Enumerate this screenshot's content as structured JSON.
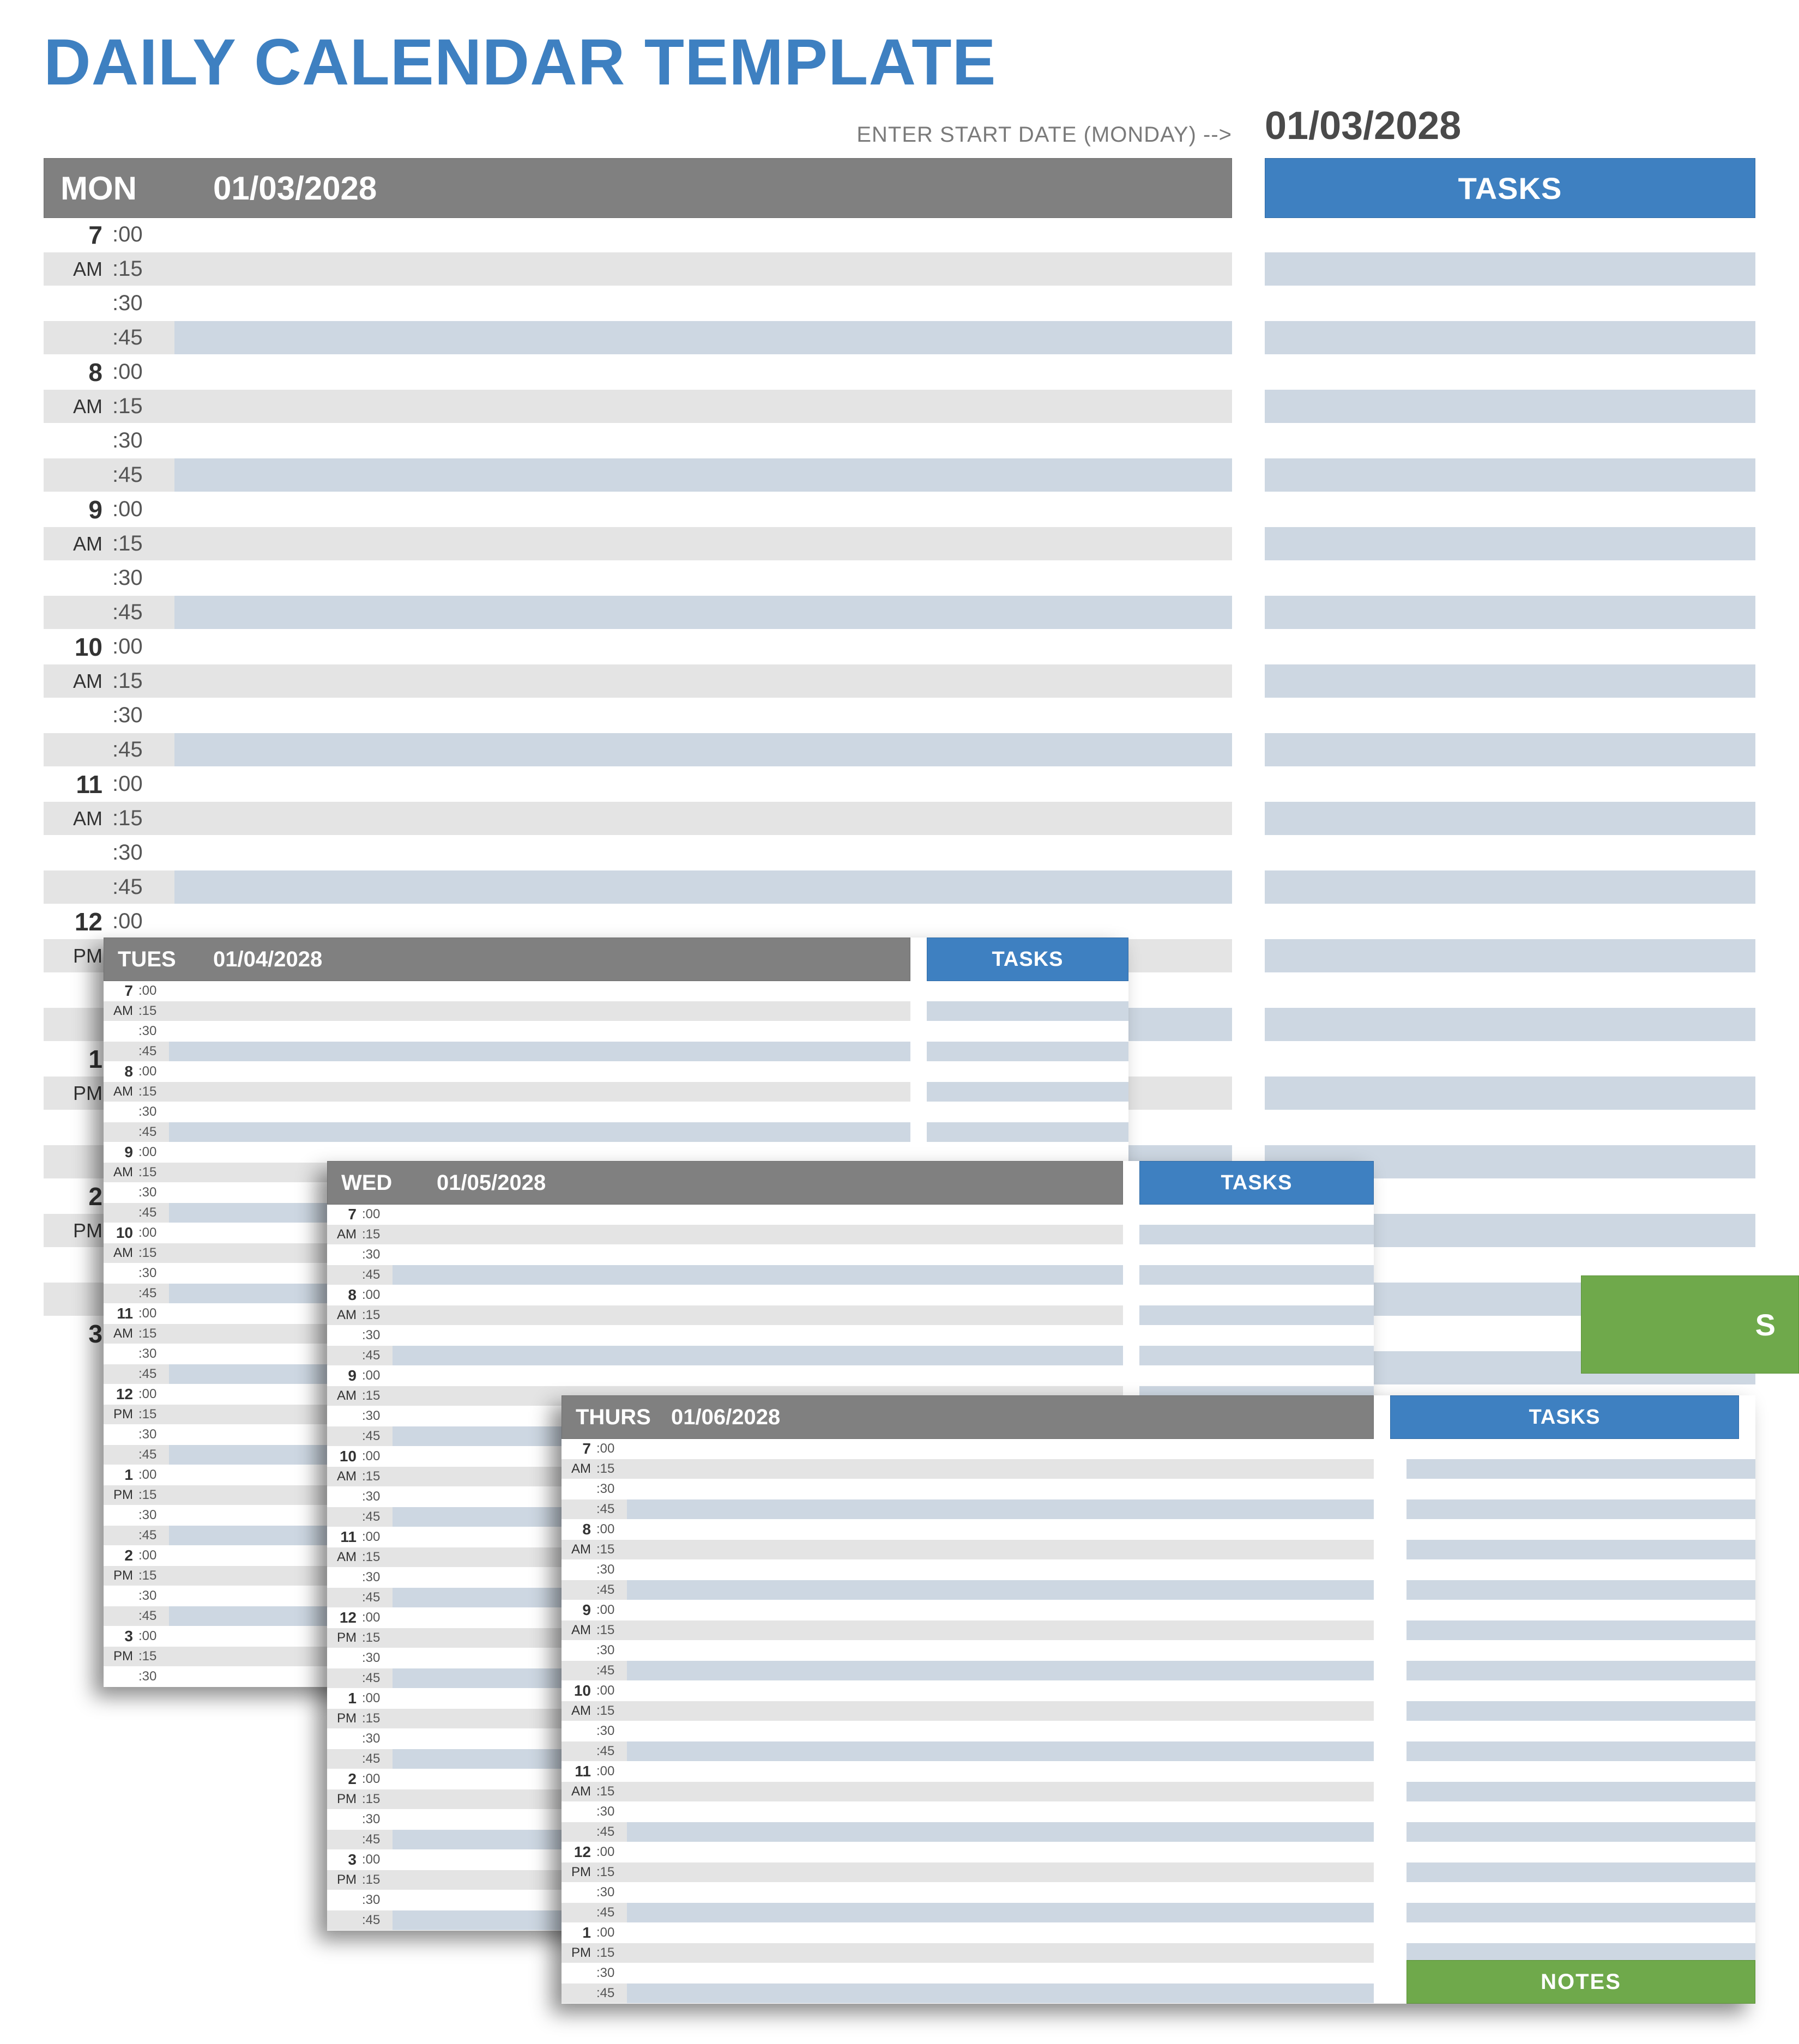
{
  "title": "DAILY CALENDAR TEMPLATE",
  "start_date_label": "ENTER START DATE (MONDAY) -->",
  "start_date_value": "01/03/2028",
  "tasks_label": "TASKS",
  "notes_label": "NOTES",
  "notes_peek": "S",
  "minutes": [
    ":00",
    ":15",
    ":30",
    ":45"
  ],
  "main": {
    "dow": "MON",
    "date": "01/03/2028",
    "hours": [
      {
        "n": "7",
        "ampm": "AM"
      },
      {
        "n": "8",
        "ampm": "AM"
      },
      {
        "n": "9",
        "ampm": "AM"
      },
      {
        "n": "10",
        "ampm": "AM"
      },
      {
        "n": "11",
        "ampm": "AM"
      },
      {
        "n": "12",
        "ampm": "PM"
      },
      {
        "n": "1",
        "ampm": "PM"
      },
      {
        "n": "2",
        "ampm": "PM"
      },
      {
        "n": "3",
        "ampm": ""
      }
    ],
    "rows_visible": 33,
    "task_rows": 38
  },
  "cascades": [
    {
      "id": "tue",
      "dow": "TUES",
      "date": "01/04/2028",
      "hours": [
        {
          "n": "7",
          "ampm": "AM"
        },
        {
          "n": "8",
          "ampm": "AM"
        },
        {
          "n": "9",
          "ampm": "AM"
        },
        {
          "n": "10",
          "ampm": "AM"
        },
        {
          "n": "11",
          "ampm": "AM"
        },
        {
          "n": "12",
          "ampm": "PM"
        },
        {
          "n": "1",
          "ampm": "PM"
        },
        {
          "n": "2",
          "ampm": "PM"
        },
        {
          "n": "3",
          "ampm": "PM"
        }
      ],
      "rows_visible": 35,
      "task_rows": 35
    },
    {
      "id": "wed",
      "dow": "WED",
      "date": "01/05/2028",
      "hours": [
        {
          "n": "7",
          "ampm": "AM"
        },
        {
          "n": "8",
          "ampm": "AM"
        },
        {
          "n": "9",
          "ampm": "AM"
        },
        {
          "n": "10",
          "ampm": "AM"
        },
        {
          "n": "11",
          "ampm": "AM"
        },
        {
          "n": "12",
          "ampm": "PM"
        },
        {
          "n": "1",
          "ampm": "PM"
        },
        {
          "n": "2",
          "ampm": "PM"
        },
        {
          "n": "3",
          "ampm": "PM"
        }
      ],
      "rows_visible": 36,
      "task_rows": 36
    },
    {
      "id": "thu",
      "dow": "THURS",
      "date": "01/06/2028",
      "hours": [
        {
          "n": "7",
          "ampm": "AM"
        },
        {
          "n": "8",
          "ampm": "AM"
        },
        {
          "n": "9",
          "ampm": "AM"
        },
        {
          "n": "10",
          "ampm": "AM"
        },
        {
          "n": "11",
          "ampm": "AM"
        },
        {
          "n": "12",
          "ampm": "PM"
        },
        {
          "n": "1",
          "ampm": "PM"
        }
      ],
      "rows_visible": 28,
      "task_rows": 26,
      "has_notes": true
    }
  ]
}
